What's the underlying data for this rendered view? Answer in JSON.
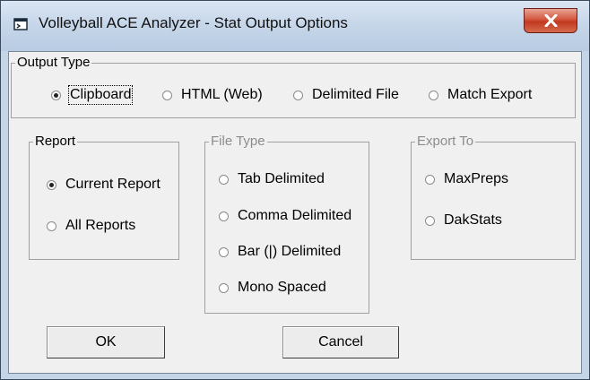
{
  "window": {
    "title": "Volleyball ACE Analyzer - Stat Output Options",
    "app_icon": "app-window-icon",
    "close_icon": "close-icon",
    "close_color": "#c8432a"
  },
  "output_type": {
    "legend": "Output Type",
    "options": [
      {
        "label": "Clipboard",
        "selected": true
      },
      {
        "label": "HTML (Web)",
        "selected": false
      },
      {
        "label": "Delimited File",
        "selected": false
      },
      {
        "label": "Match Export",
        "selected": false
      }
    ]
  },
  "report": {
    "legend": "Report",
    "options": [
      {
        "label": "Current Report",
        "selected": true
      },
      {
        "label": "All Reports",
        "selected": false
      }
    ]
  },
  "file_type": {
    "legend": "File Type",
    "options": [
      {
        "label": "Tab Delimited",
        "selected": false
      },
      {
        "label": "Comma Delimited",
        "selected": false
      },
      {
        "label": "Bar (|) Delimited",
        "selected": false
      },
      {
        "label": "Mono Spaced",
        "selected": false
      }
    ]
  },
  "export_to": {
    "legend": "Export To",
    "options": [
      {
        "label": "MaxPreps",
        "selected": false
      },
      {
        "label": "DakStats",
        "selected": false
      }
    ]
  },
  "buttons": {
    "ok": "OK",
    "cancel": "Cancel"
  }
}
